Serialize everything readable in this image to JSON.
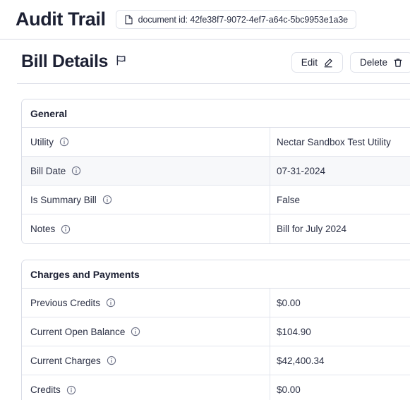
{
  "appbar": {
    "title": "Audit Trail",
    "document_chip": {
      "icon": "document-icon",
      "text": "document id: 42fe38f7-9072-4ef7-a64c-5bc9953e1a3e"
    }
  },
  "page": {
    "title": "Bill Details",
    "flag_icon": "flag-icon",
    "actions": [
      {
        "label": "Edit",
        "icon": "pencil-icon"
      },
      {
        "label": "Delete",
        "icon": "trash-icon"
      }
    ]
  },
  "colors": {
    "text": "#1c2033",
    "border": "#d9dce6",
    "row_shaded": "#f7f8fa",
    "background": "#ffffff"
  },
  "sections": [
    {
      "title": "General",
      "rows": [
        {
          "label": "Utility",
          "info": "info-icon",
          "value": "Nectar Sandbox Test Utility",
          "shaded": false
        },
        {
          "label": "Bill Date",
          "info": "info-icon",
          "value": "07-31-2024",
          "shaded": true
        },
        {
          "label": "Is Summary Bill",
          "info": "info-icon",
          "value": "False",
          "shaded": false
        },
        {
          "label": "Notes",
          "info": "info-icon",
          "value": "Bill for July 2024",
          "shaded": false
        }
      ]
    },
    {
      "title": "Charges and Payments",
      "rows": [
        {
          "label": "Previous Credits",
          "info": "info-icon",
          "value": "$0.00",
          "shaded": false
        },
        {
          "label": "Current Open Balance",
          "info": "info-icon",
          "value": "$104.90",
          "shaded": false
        },
        {
          "label": "Current Charges",
          "info": "info-icon",
          "value": "$42,400.34",
          "shaded": false
        },
        {
          "label": "Credits",
          "info": "info-icon",
          "value": "$0.00",
          "shaded": false
        }
      ]
    }
  ]
}
